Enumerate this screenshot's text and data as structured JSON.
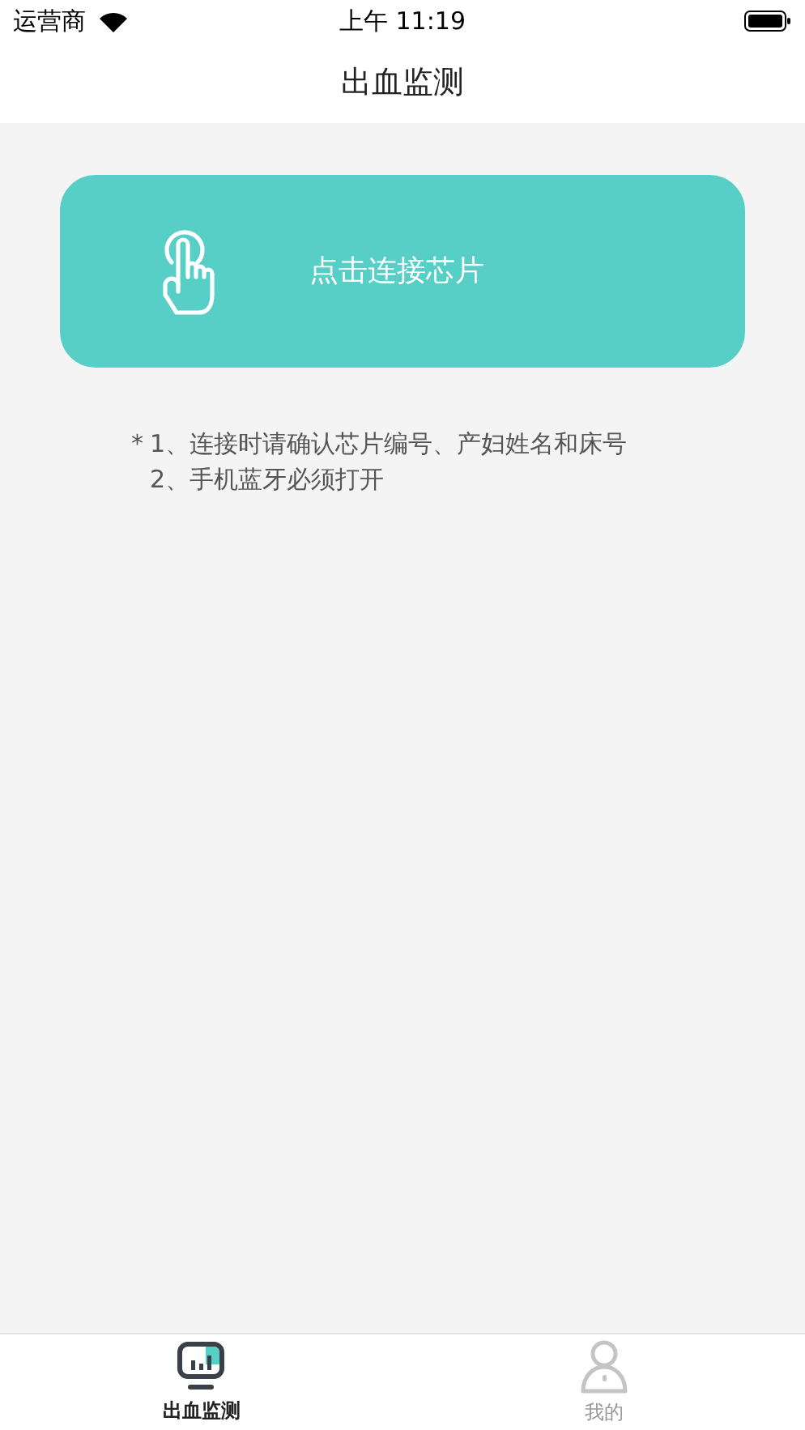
{
  "status_bar": {
    "carrier": "运营商",
    "time": "上午 11:19"
  },
  "nav": {
    "title": "出血监测"
  },
  "connect_button": {
    "label": "点击连接芯片"
  },
  "notes": {
    "marker": "*",
    "items": [
      "1、连接时请确认芯片编号、产妇姓名和床号",
      "2、手机蓝牙必须打开"
    ]
  },
  "tabs": [
    {
      "kind": "monitor",
      "label": "出血监测",
      "selected": true
    },
    {
      "kind": "profile",
      "label": "我的",
      "selected": false
    }
  ]
}
